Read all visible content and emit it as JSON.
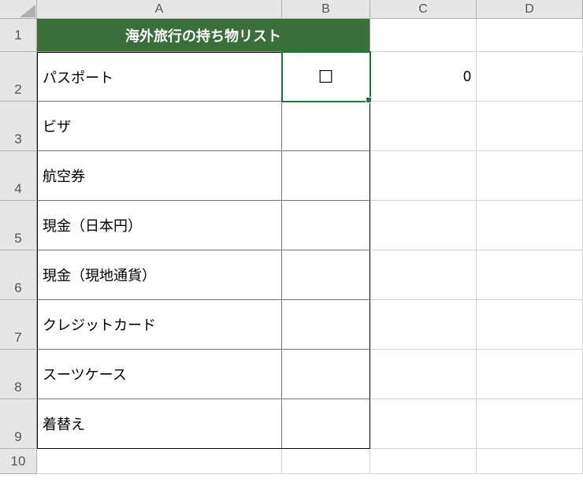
{
  "columns": [
    "A",
    "B",
    "C",
    "D"
  ],
  "rows": [
    "1",
    "2",
    "3",
    "4",
    "5",
    "6",
    "7",
    "8",
    "9",
    "10"
  ],
  "title": "海外旅行の持ち物リスト",
  "items": [
    "パスポート",
    "ビザ",
    "航空券",
    "現金（日本円）",
    "現金（現地通貨）",
    "クレジットカード",
    "スーツケース",
    "着替え"
  ],
  "b2_symbol": "☐",
  "c2_value": "0",
  "selected_cell": "B2",
  "colors": {
    "header_bg": "#3a6e3a",
    "selection": "#1a7a3c"
  }
}
